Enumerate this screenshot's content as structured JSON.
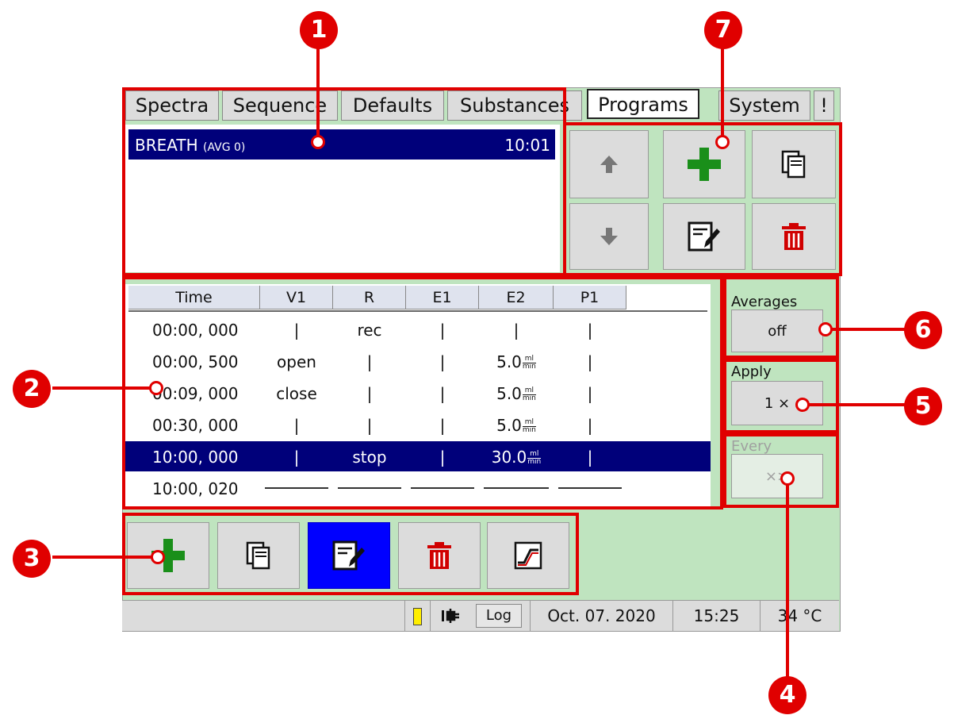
{
  "tabs": [
    {
      "label": "Spectra",
      "active": false
    },
    {
      "label": "Sequence",
      "active": false
    },
    {
      "label": "Defaults",
      "active": false
    },
    {
      "label": "Substances",
      "active": false
    },
    {
      "label": "Programs",
      "active": true
    },
    {
      "label": "System",
      "active": false
    },
    {
      "label": "!",
      "active": false
    }
  ],
  "program_list": {
    "selected": {
      "name": "BREATH",
      "avg": "(AVG 0)",
      "time": "10:01"
    }
  },
  "program_buttons": [
    "up-arrow-icon",
    "add-icon",
    "copy-icon",
    "down-arrow-icon",
    "edit-icon",
    "delete-icon"
  ],
  "table": {
    "headers": [
      "Time",
      "V1",
      "R",
      "E1",
      "E2",
      "P1"
    ],
    "unit": {
      "num": "ml",
      "den": "min"
    },
    "rows": [
      {
        "time": "00:00, 000",
        "v1": "|",
        "r": "rec",
        "e1": "|",
        "e2": "|",
        "e2_unit": false,
        "p1": "|",
        "selected": false
      },
      {
        "time": "00:00, 500",
        "v1": "open",
        "r": "|",
        "e1": "|",
        "e2": "5.0",
        "e2_unit": true,
        "p1": "|",
        "selected": false
      },
      {
        "time": "00:09, 000",
        "v1": "close",
        "r": "|",
        "e1": "|",
        "e2": "5.0",
        "e2_unit": true,
        "p1": "|",
        "selected": false
      },
      {
        "time": "00:30, 000",
        "v1": "|",
        "r": "|",
        "e1": "|",
        "e2": "5.0",
        "e2_unit": true,
        "p1": "|",
        "selected": false
      },
      {
        "time": "10:00, 000",
        "v1": "|",
        "r": "stop",
        "e1": "|",
        "e2": "30.0",
        "e2_unit": true,
        "p1": "|",
        "selected": true
      },
      {
        "time": "10:00, 020",
        "v1": "",
        "r": "",
        "e1": "",
        "e2": "",
        "e2_unit": false,
        "p1": "",
        "selected": false,
        "end": true
      }
    ]
  },
  "side": {
    "averages_label": "Averages",
    "averages_value": "off",
    "apply_label": "Apply",
    "apply_value": "1 ×",
    "every_label": "Every",
    "every_value": "×>"
  },
  "step_buttons": [
    "add-icon",
    "copy-icon",
    "edit-icon",
    "delete-icon",
    "chart-icon"
  ],
  "status": {
    "log": "Log",
    "date": "Oct. 07. 2020",
    "time": "15:25",
    "temp": "34 °C"
  },
  "callouts": [
    "1",
    "2",
    "3",
    "4",
    "5",
    "6",
    "7"
  ],
  "colors": {
    "highlight": "#00007a",
    "green_bg": "#bfe4bf",
    "red": "#e00000",
    "add_green": "#1a8f1a",
    "delete_red": "#d00000",
    "edit_active": "#0000ff"
  }
}
